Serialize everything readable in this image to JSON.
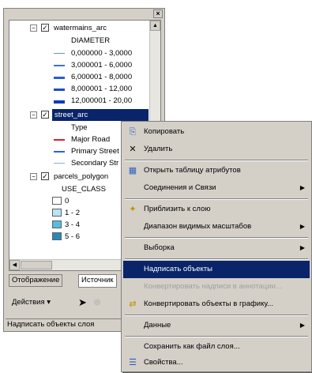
{
  "toc": {
    "layers": [
      {
        "name": "watermains_arc",
        "field": "DIAMETER",
        "classes": [
          {
            "label": "0,000000 - 3,0000",
            "color": "#6a8ee0",
            "width": 1
          },
          {
            "label": "3,000001 - 6,0000",
            "color": "#3f6fd8",
            "width": 2
          },
          {
            "label": "6,000001 - 8,0000",
            "color": "#2a5cd0",
            "width": 3
          },
          {
            "label": "8,000001 - 12,000",
            "color": "#1a4cc8",
            "width": 3
          },
          {
            "label": "12,000001 - 20,00",
            "color": "#0a3cc0",
            "width": 4
          }
        ]
      },
      {
        "name": "street_arc",
        "field": "Type",
        "classes": [
          {
            "label": "Major Road",
            "color": "#d8202a",
            "width": 2
          },
          {
            "label": "Primary Street",
            "color": "#3060d8",
            "width": 2
          },
          {
            "label": "Secondary Str",
            "color": "#8aa8e8",
            "width": 1
          }
        ]
      },
      {
        "name": "parcels_polygon",
        "field": "USE_CLASS",
        "classes": [
          {
            "label": "0",
            "color": "#ffffff"
          },
          {
            "label": "1 - 2",
            "color": "#b8e4f4"
          },
          {
            "label": "3 - 4",
            "color": "#58bce0"
          },
          {
            "label": "5 - 6",
            "color": "#2a88b8"
          }
        ]
      }
    ],
    "tabs": [
      "Отображение",
      "Источник"
    ],
    "toolbar": {
      "actions_label": "Действия ▾"
    },
    "status": "Надписать объекты слоя"
  },
  "menu": {
    "items": [
      {
        "label": "Копировать",
        "icon": "copy-icon",
        "glyph": "⎘"
      },
      {
        "label": "Удалить",
        "icon": "delete-icon",
        "glyph": "✕"
      },
      {
        "label": "Открыть таблицу атрибутов",
        "icon": "table-icon",
        "glyph": "▦"
      },
      {
        "label": "Соединения и Связи",
        "submenu": true
      },
      {
        "label": "Приблизить к слою",
        "icon": "zoom-to-layer-icon",
        "glyph": "✦"
      },
      {
        "label": "Диапазон видимых масштабов",
        "submenu": true
      },
      {
        "label": "Выборка",
        "submenu": true
      },
      {
        "label": "Надписать объекты",
        "highlighted": true
      },
      {
        "label": "Конвертировать надписи в аннотации...",
        "disabled": true
      },
      {
        "label": "Конвертировать объекты в графику...",
        "icon": "convert-graphics-icon",
        "glyph": "⇄"
      },
      {
        "label": "Данные",
        "submenu": true
      },
      {
        "label": "Сохранить как файл слоя..."
      },
      {
        "label": "Свойства...",
        "icon": "properties-icon",
        "glyph": "☰"
      }
    ]
  }
}
